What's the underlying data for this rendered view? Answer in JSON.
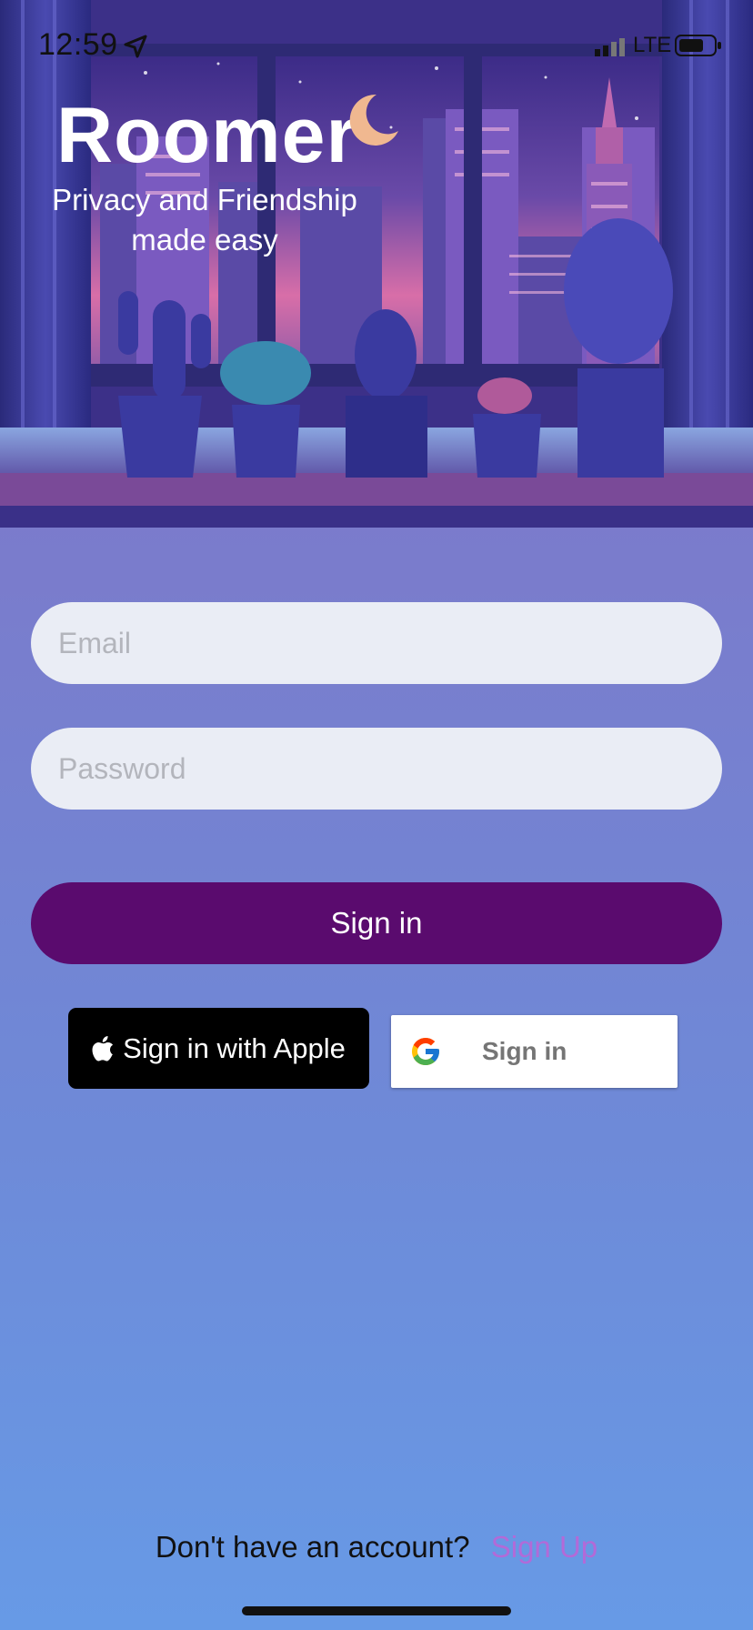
{
  "status_bar": {
    "time": "12:59",
    "network": "LTE"
  },
  "brand": {
    "name": "Roomer",
    "tagline_line1": "Privacy and Friendship",
    "tagline_line2": "made easy"
  },
  "form": {
    "email_placeholder": "Email",
    "password_placeholder": "Password",
    "signin_label": "Sign in"
  },
  "social": {
    "apple_label": "Sign in with Apple",
    "google_label": "Sign in"
  },
  "footer": {
    "question": "Don't have an account?",
    "signup_label": "Sign Up"
  },
  "colors": {
    "primary_button": "#5a0b6e",
    "signup_link": "#b26ad8",
    "field_bg": "#eaedf5"
  }
}
